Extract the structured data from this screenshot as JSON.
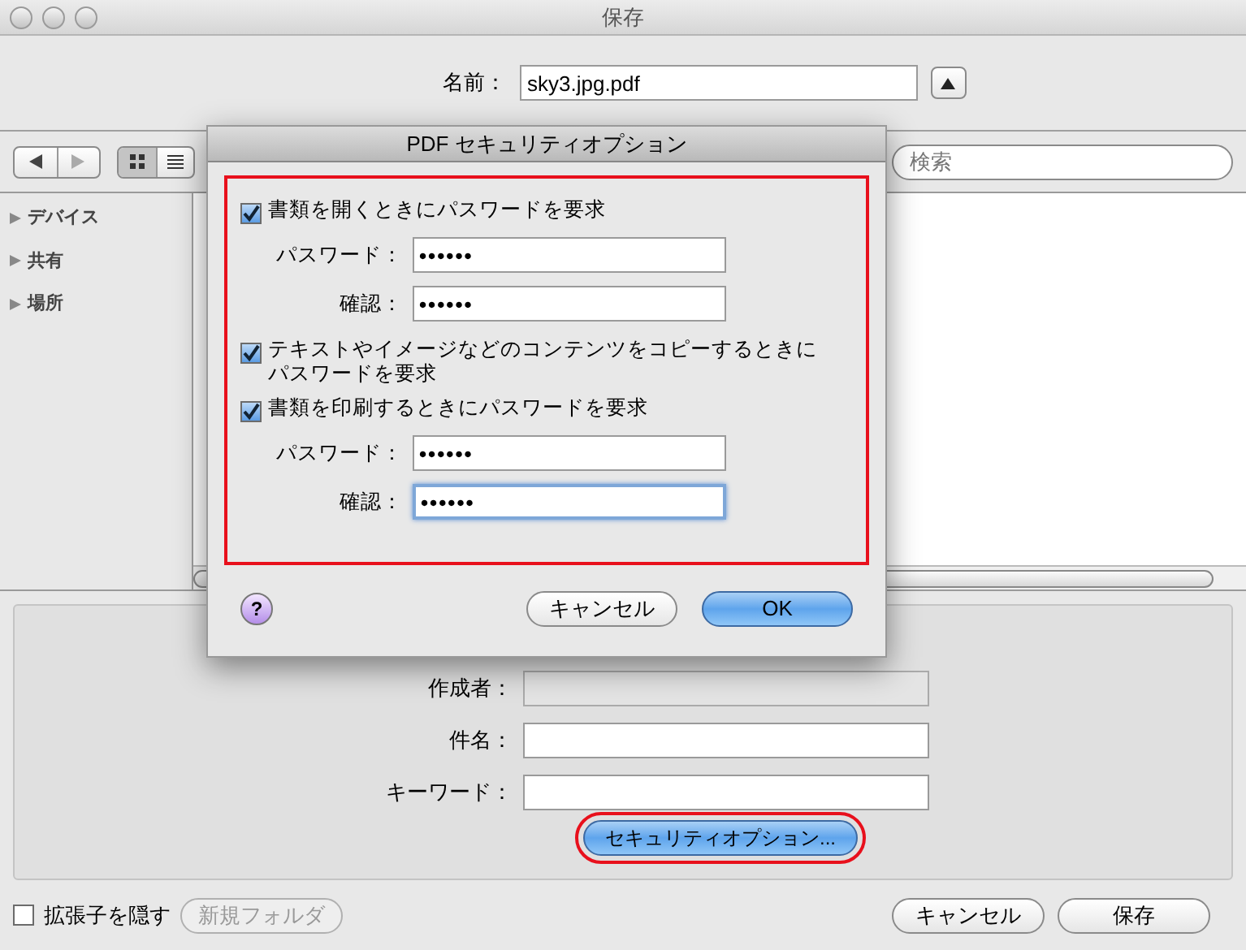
{
  "window": {
    "title": "保存"
  },
  "name_field": {
    "label": "名前：",
    "value": "sky3.jpg.pdf"
  },
  "search": {
    "placeholder": "検索"
  },
  "sidebar": {
    "items": [
      {
        "label": "デバイス",
        "expanded": false
      },
      {
        "label": "共有",
        "expanded": false
      },
      {
        "label": "場所",
        "expanded": false
      }
    ]
  },
  "view_modes": [
    {
      "kind": "icons",
      "selected": true
    },
    {
      "kind": "list",
      "selected": false
    }
  ],
  "metadata": [
    {
      "label": "作成者：",
      "disabled": true
    },
    {
      "label": "件名：",
      "disabled": false
    },
    {
      "label": "キーワード：",
      "disabled": false
    }
  ],
  "security_button": "セキュリティオプション...",
  "hide_extension": {
    "label": "拡張子を隠す",
    "checked": false
  },
  "new_folder_button": {
    "label": "新規フォルダ",
    "disabled": true
  },
  "buttons": {
    "cancel": "キャンセル",
    "save": "保存"
  },
  "sheet": {
    "title": "PDF セキュリティオプション",
    "options": [
      {
        "kind": "checkbox",
        "label": "書類を開くときにパスワードを要求",
        "checked": true
      },
      {
        "kind": "field",
        "label": "パスワード：",
        "value": "••••••",
        "focused": false
      },
      {
        "kind": "field",
        "label": "確認：",
        "value": "••••••",
        "focused": false
      },
      {
        "kind": "checkbox",
        "label": "テキストやイメージなどのコンテンツをコピーするときにパスワードを要求",
        "checked": true
      },
      {
        "kind": "checkbox",
        "label": "書類を印刷するときにパスワードを要求",
        "checked": true
      },
      {
        "kind": "field",
        "label": "パスワード：",
        "value": "••••••",
        "focused": false
      },
      {
        "kind": "field",
        "label": "確認：",
        "value": "••••••",
        "focused": true
      }
    ],
    "help": "?",
    "cancel": "キャンセル",
    "ok": "OK"
  }
}
